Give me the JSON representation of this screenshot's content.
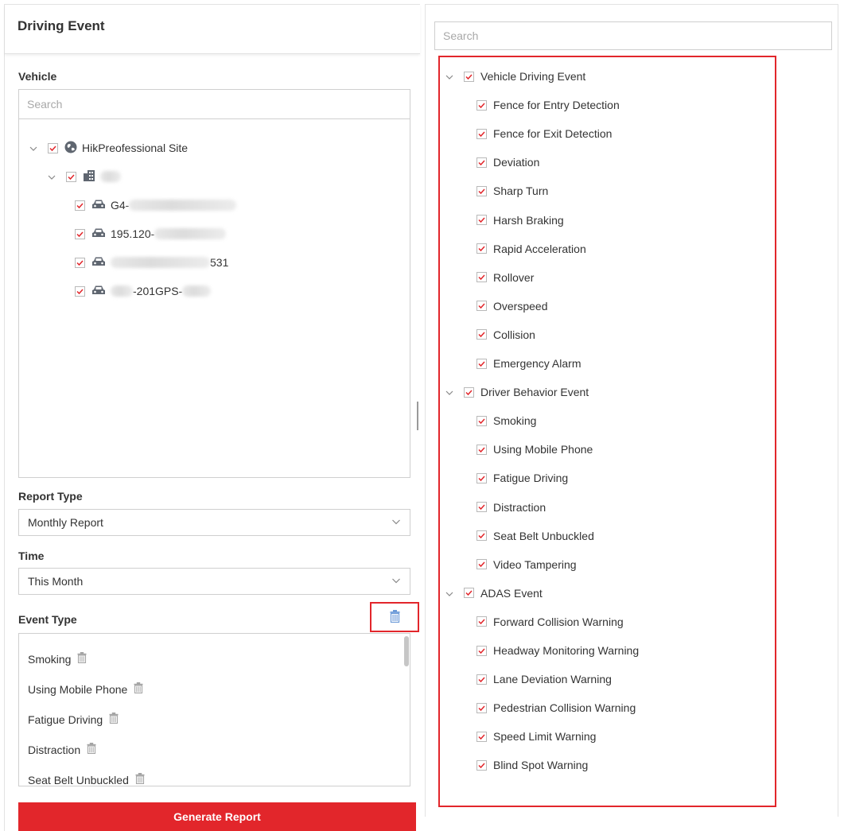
{
  "left_panel": {
    "title": "Driving Event",
    "vehicle": {
      "label": "Vehicle",
      "search_placeholder": "Search",
      "tree": {
        "site_label": "HikPreofessional Site",
        "vehicles": [
          {
            "label_prefix": "G4-",
            "label_suffix": ""
          },
          {
            "label_prefix": "195.120-",
            "label_suffix": ""
          },
          {
            "label_prefix": "",
            "label_suffix": "531"
          },
          {
            "label_prefix": "",
            "label_suffix": "-201GPS-"
          }
        ]
      }
    },
    "report_type": {
      "label": "Report Type",
      "value": "Monthly Report"
    },
    "time": {
      "label": "Time",
      "value": "This Month"
    },
    "event_type": {
      "label": "Event Type",
      "items": [
        "Smoking",
        "Using Mobile Phone",
        "Fatigue Driving",
        "Distraction",
        "Seat Belt Unbuckled"
      ]
    },
    "generate_button": "Generate Report"
  },
  "right_panel": {
    "search_placeholder": "Search",
    "groups": [
      {
        "label": "Vehicle Driving Event",
        "items": [
          "Fence for Entry Detection",
          "Fence for Exit Detection",
          "Deviation",
          "Sharp Turn",
          "Harsh Braking",
          "Rapid Acceleration",
          "Rollover",
          "Overspeed",
          "Collision",
          "Emergency Alarm"
        ]
      },
      {
        "label": "Driver Behavior Event",
        "items": [
          "Smoking",
          "Using Mobile Phone",
          "Fatigue Driving",
          "Distraction",
          "Seat Belt Unbuckled",
          "Video Tampering"
        ]
      },
      {
        "label": "ADAS Event",
        "items": [
          "Forward Collision Warning",
          "Headway Monitoring Warning",
          "Lane Deviation Warning",
          "Pedestrian Collision Warning",
          "Speed Limit Warning",
          "Blind Spot Warning"
        ]
      }
    ]
  },
  "colors": {
    "accent": "#e2262b",
    "check": "#e2262b",
    "trash_blue": "#6c9ad8"
  },
  "icons": {
    "check": "check-icon",
    "chevron": "chevron-down-icon",
    "globe": "globe-icon",
    "building": "building-icon",
    "car": "car-icon",
    "trash": "trash-icon"
  }
}
